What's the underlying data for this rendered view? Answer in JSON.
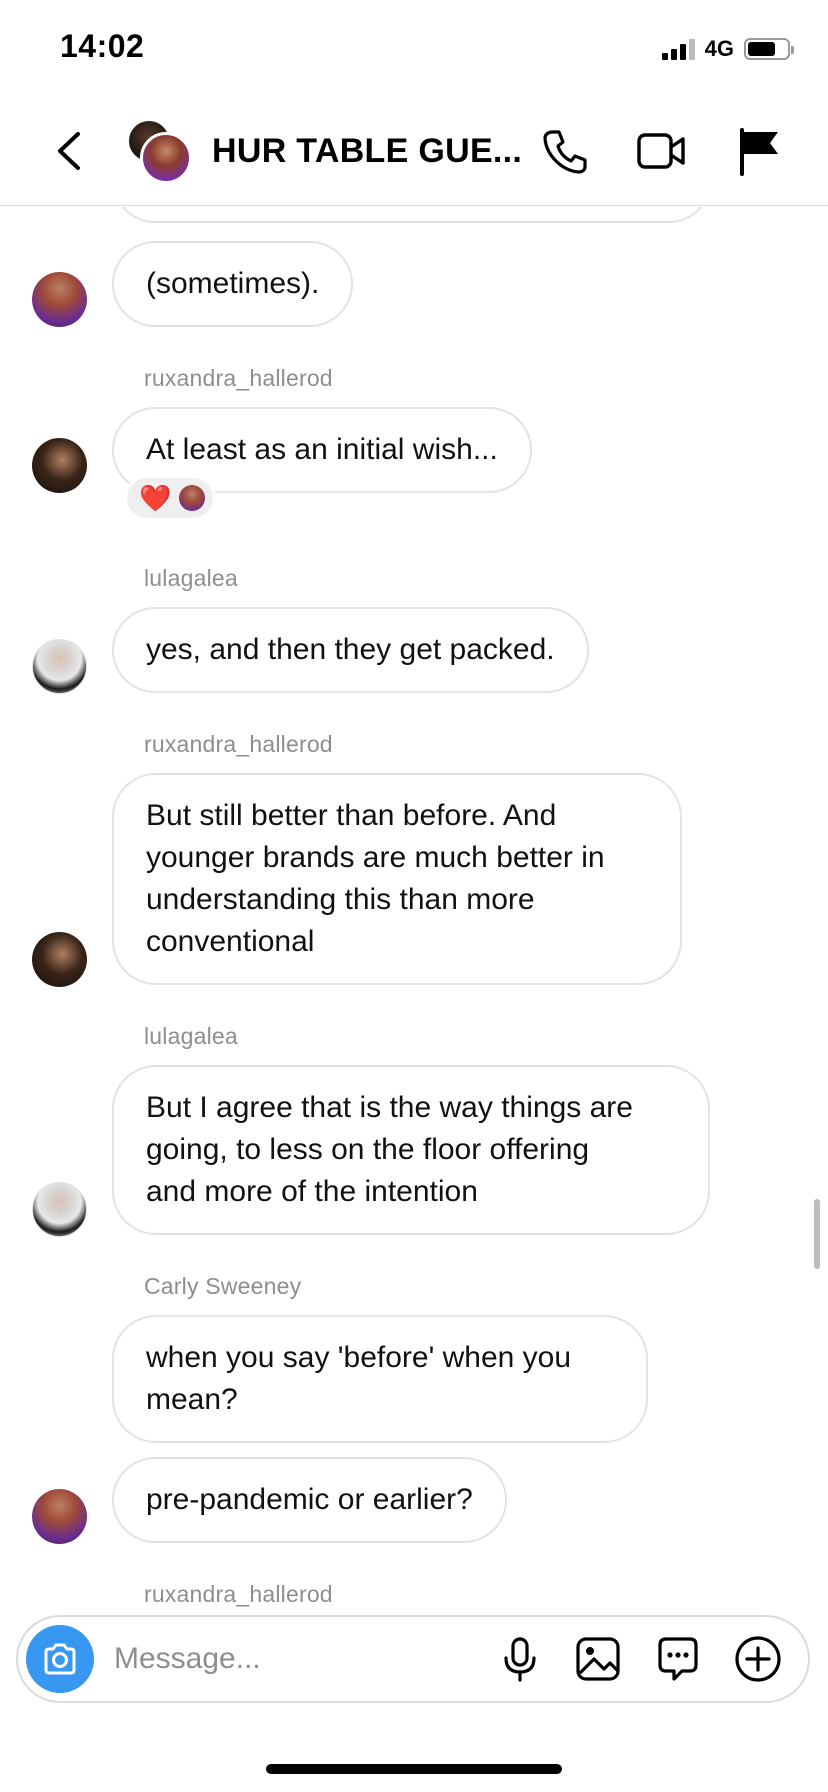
{
  "status_bar": {
    "time": "14:02",
    "network": "4G",
    "signal_bars": 4,
    "battery_level": 0.7
  },
  "header": {
    "title": "HUR TABLE GUE...",
    "back_icon": "chevron-left-icon",
    "call_icon": "phone-icon",
    "video_icon": "video-camera-icon",
    "flag_icon": "flag-icon"
  },
  "messages": [
    {
      "id": "m0",
      "text": "(sometimes).",
      "sender": "",
      "avatar": "carly"
    },
    {
      "id": "m1",
      "text": "At least as an initial wish...",
      "sender": "ruxandra_hallerod",
      "avatar": "rux",
      "reaction": "❤️"
    },
    {
      "id": "m2",
      "text": "yes, and then they get packed.",
      "sender": "lulagalea",
      "avatar": "lula"
    },
    {
      "id": "m3",
      "lines": [
        "But still better than before. And",
        "younger brands are much better in",
        "understanding this than more",
        "conventional"
      ],
      "sender": "ruxandra_hallerod",
      "avatar": "rux"
    },
    {
      "id": "m4",
      "lines": [
        "But I agree that is the way things are",
        "going, to less on the floor offering",
        "and more of the intention"
      ],
      "sender": "lulagalea",
      "avatar": "lula"
    },
    {
      "id": "m5",
      "lines": [
        "when you say 'before' when you",
        "mean?"
      ],
      "sender": "Carly Sweeney",
      "avatar": "none"
    },
    {
      "id": "m6",
      "text": "pre-pandemic or earlier?",
      "sender": "",
      "avatar": "carly"
    },
    {
      "id": "m7",
      "text": "",
      "sender": "ruxandra_hallerod",
      "avatar": "none"
    }
  ],
  "composer": {
    "placeholder": "Message...",
    "camera_icon": "camera-icon",
    "mic_icon": "microphone-icon",
    "gallery_icon": "image-icon",
    "sticker_icon": "chat-sticker-icon",
    "plus_icon": "plus-circle-icon"
  },
  "colors": {
    "accent": "#3897f0",
    "bubble_border": "#e3e3e3",
    "meta_text": "#8e8e8e",
    "reaction_heart": "#e0245e"
  }
}
